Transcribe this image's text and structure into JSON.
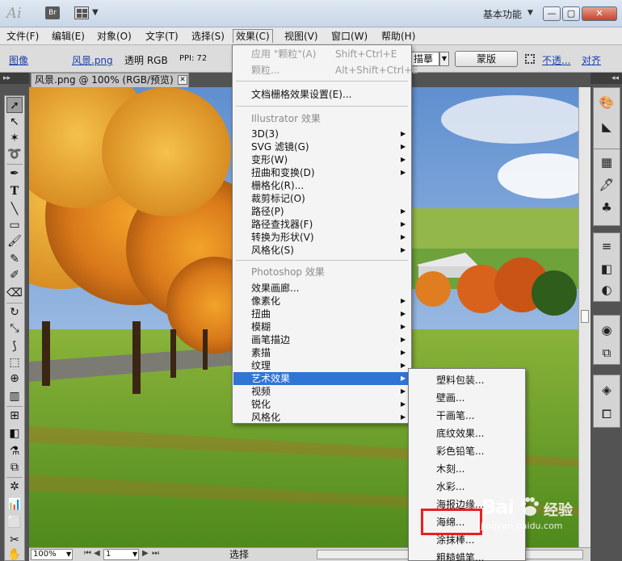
{
  "app": {
    "logo": "Ai",
    "bridge_label": "Br",
    "workspace_label": "基本功能",
    "window_buttons": [
      "—",
      "▢",
      "✕"
    ]
  },
  "menubar": {
    "items": [
      "文件(F)",
      "编辑(E)",
      "对象(O)",
      "文字(T)",
      "选择(S)",
      "效果(C)",
      "视图(V)",
      "窗口(W)",
      "帮助(H)"
    ],
    "active_index": 5
  },
  "controlbar": {
    "image_label": "图像",
    "filename_link": "风景.png",
    "mode_text": "透明 RGB",
    "ppi_text": "PPI: 72",
    "trace_field": "描摹",
    "mask_button": "蒙版",
    "opacity_link": "不透...",
    "align_link": "对齐"
  },
  "document": {
    "tab_title": "风景.png @ 100% (RGB/预览)",
    "zoom": "100%",
    "artboard": "1",
    "status_tool": "选择"
  },
  "effect_menu": {
    "apply_last": "应用 \"颗粒\"(A)",
    "apply_last_shortcut": "Shift+Ctrl+E",
    "last_effect": "颗粒...",
    "last_effect_shortcut": "Alt+Shift+Ctrl+E",
    "raster_settings": "文档栅格效果设置(E)...",
    "illustrator_header": "Illustrator 效果",
    "illustrator_items": [
      {
        "label": "3D(3)",
        "submenu": true
      },
      {
        "label": "SVG 滤镜(G)",
        "submenu": true
      },
      {
        "label": "变形(W)",
        "submenu": true
      },
      {
        "label": "扭曲和变换(D)",
        "submenu": true
      },
      {
        "label": "栅格化(R)...",
        "submenu": false
      },
      {
        "label": "裁剪标记(O)",
        "submenu": false
      },
      {
        "label": "路径(P)",
        "submenu": true
      },
      {
        "label": "路径查找器(F)",
        "submenu": true
      },
      {
        "label": "转换为形状(V)",
        "submenu": true
      },
      {
        "label": "风格化(S)",
        "submenu": true
      }
    ],
    "photoshop_header": "Photoshop 效果",
    "photoshop_items": [
      {
        "label": "效果画廊...",
        "submenu": false
      },
      {
        "label": "像素化",
        "submenu": true
      },
      {
        "label": "扭曲",
        "submenu": true
      },
      {
        "label": "模糊",
        "submenu": true
      },
      {
        "label": "画笔描边",
        "submenu": true
      },
      {
        "label": "素描",
        "submenu": true
      },
      {
        "label": "纹理",
        "submenu": true
      },
      {
        "label": "艺术效果",
        "submenu": true
      },
      {
        "label": "视频",
        "submenu": true
      },
      {
        "label": "锐化",
        "submenu": true
      },
      {
        "label": "风格化",
        "submenu": true
      }
    ],
    "highlighted_label": "艺术效果"
  },
  "artistic_submenu": {
    "items": [
      "塑料包装...",
      "壁画...",
      "干画笔...",
      "底纹效果...",
      "彩色铅笔...",
      "木刻...",
      "水彩...",
      "海报边缘...",
      "海绵...",
      "涂抹棒...",
      "粗糙蜡笔..."
    ],
    "annotated_item": "海绵..."
  },
  "watermark": {
    "brand_latin": "Bai",
    "brand_latin2": "du",
    "brand_cn": "经验",
    "url": "jingyan.baidu.com"
  },
  "colors": {
    "menu_highlight": "#3074d4",
    "annotation_red": "#e52222",
    "link_blue": "#1b3fa8"
  }
}
